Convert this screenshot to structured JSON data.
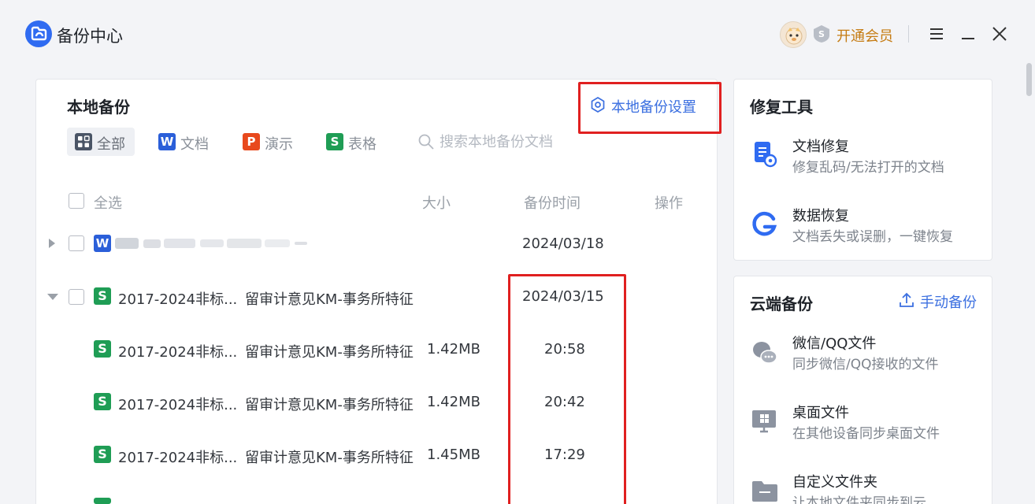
{
  "window": {
    "title": "备份中心",
    "vip_label": "开通会员"
  },
  "local": {
    "title": "本地备份",
    "settings_label": "本地备份设置",
    "filters": [
      {
        "label": "全部",
        "icon": "grid-icon"
      },
      {
        "label": "文档",
        "icon": "W"
      },
      {
        "label": "演示",
        "icon": "P"
      },
      {
        "label": "表格",
        "icon": "S"
      }
    ],
    "search_placeholder": "搜索本地备份文档",
    "columns": {
      "select_all": "全选",
      "size": "大小",
      "time": "备份时间",
      "action": "操作"
    },
    "groups": [
      {
        "date": "2024/03/18",
        "collapsed": true,
        "file_type": "W"
      },
      {
        "name": "2017-2024非标...",
        "name_tail": "留审计意见KM-事务所特征",
        "date": "2024/03/15",
        "collapsed": false,
        "file_type": "S",
        "items": [
          {
            "name": "2017-2024非标...",
            "name_tail": "留审计意见KM-事务所特征",
            "size": "1.42MB",
            "time": "20:58"
          },
          {
            "name": "2017-2024非标...",
            "name_tail": "留审计意见KM-事务所特征",
            "size": "1.42MB",
            "time": "20:42"
          },
          {
            "name": "2017-2024非标...",
            "name_tail": "留审计意见KM-事务所特征",
            "size": "1.45MB",
            "time": "17:29"
          }
        ]
      }
    ]
  },
  "repair": {
    "title": "修复工具",
    "tools": [
      {
        "name": "文档修复",
        "desc": "修复乱码/无法打开的文档"
      },
      {
        "name": "数据恢复",
        "desc": "文档丢失或误删，一键恢复"
      }
    ]
  },
  "cloud": {
    "title": "云端备份",
    "manual_label": "手动备份",
    "items": [
      {
        "name": "微信/QQ文件",
        "desc": "同步微信/QQ接收的文件"
      },
      {
        "name": "桌面文件",
        "desc": "在其他设备同步桌面文件"
      },
      {
        "name": "自定义文件夹",
        "desc": "让本地文件夹同步到云"
      }
    ]
  },
  "colors": {
    "accent": "#3b6fe0",
    "vip": "#c57b12",
    "highlight": "#e02020",
    "sheet": "#1f9d55",
    "word": "#2b5fd9",
    "ppt": "#e8491d"
  }
}
